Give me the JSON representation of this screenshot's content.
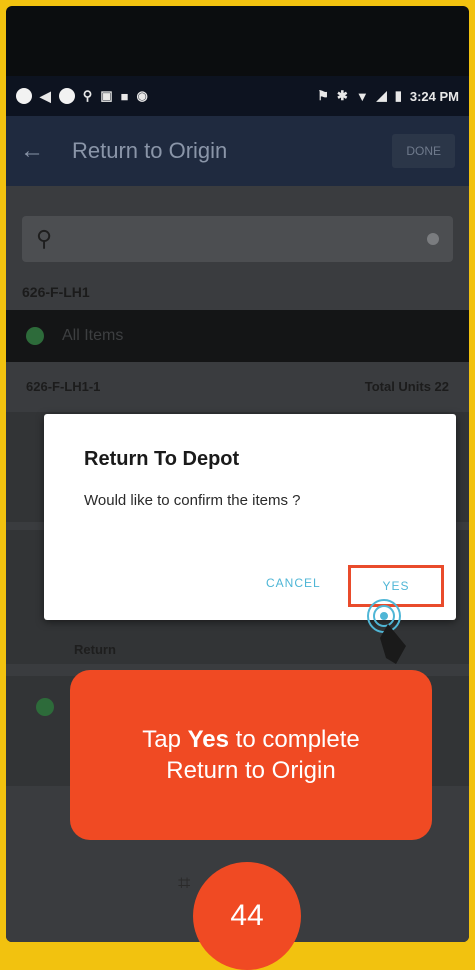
{
  "status_bar": {
    "time": "3:24 PM"
  },
  "app_bar": {
    "title": "Return to Origin",
    "back_icon": "arrow-left-icon",
    "done_label": "DONE"
  },
  "search": {
    "icon": "search-icon",
    "clear_icon": "clear-icon"
  },
  "location_label": "626-F-LH1",
  "status_row": {
    "icon": "check-circle-icon",
    "label": "All Items"
  },
  "subheader": {
    "left": "626-F-LH1-1",
    "right": "Total Units 22"
  },
  "background_row_label": "Return",
  "dialog": {
    "title": "Return To Depot",
    "message": "Would like to confirm the items ?",
    "cancel_label": "CANCEL",
    "yes_label": "YES"
  },
  "callout": {
    "prefix": "Tap ",
    "emphasis": "Yes",
    "suffix": " to complete",
    "line2": "Return to Origin"
  },
  "step_number": "44",
  "colors": {
    "frame": "#f2c20f",
    "accent": "#f04a23",
    "dialog_button_text": "#4fb6d6",
    "highlight_border": "#e94b2b"
  }
}
